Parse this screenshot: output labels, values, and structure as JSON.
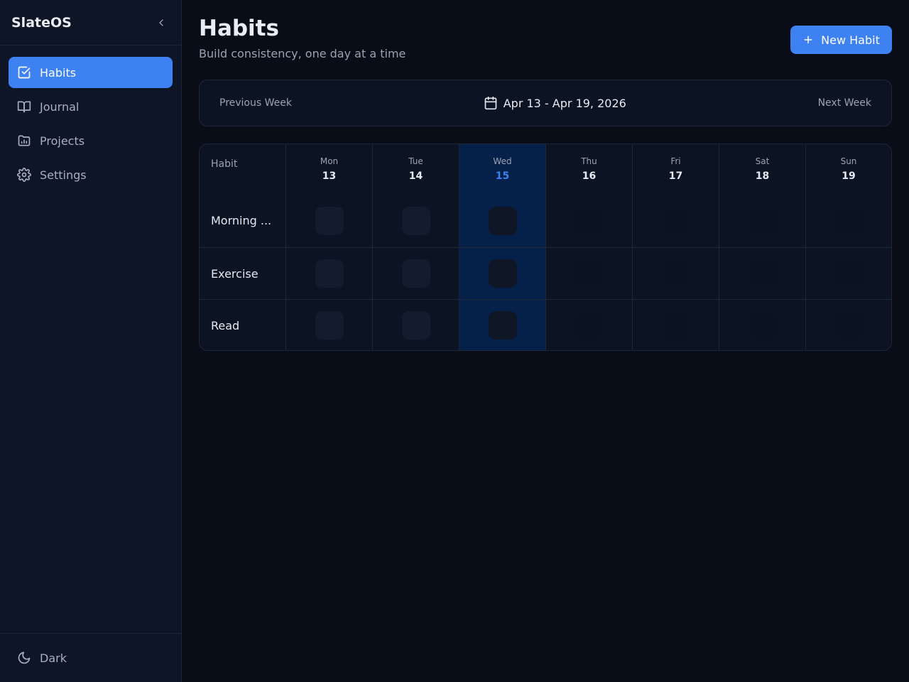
{
  "app": {
    "brand": "SlateOS"
  },
  "sidebar": {
    "items": [
      {
        "label": "Habits",
        "icon": "check-square-icon",
        "active": true
      },
      {
        "label": "Journal",
        "icon": "book-open-icon",
        "active": false
      },
      {
        "label": "Projects",
        "icon": "folder-chart-icon",
        "active": false
      },
      {
        "label": "Settings",
        "icon": "gear-icon",
        "active": false
      }
    ],
    "theme_label": "Dark",
    "theme_icon": "moon-icon"
  },
  "header": {
    "title": "Habits",
    "subtitle": "Build consistency, one day at a time",
    "new_button_label": "New Habit"
  },
  "week": {
    "prev_label": "Previous Week",
    "next_label": "Next Week",
    "range": "Apr 13 - Apr 19, 2026"
  },
  "grid": {
    "habit_header": "Habit",
    "days": [
      {
        "name": "Mon",
        "num": "13"
      },
      {
        "name": "Tue",
        "num": "14"
      },
      {
        "name": "Wed",
        "num": "15",
        "today": true
      },
      {
        "name": "Thu",
        "num": "16"
      },
      {
        "name": "Fri",
        "num": "17"
      },
      {
        "name": "Sat",
        "num": "18"
      },
      {
        "name": "Sun",
        "num": "19"
      }
    ],
    "habits": [
      {
        "name": "Morning ..."
      },
      {
        "name": "Exercise"
      },
      {
        "name": "Read"
      }
    ]
  },
  "colors": {
    "accent": "#3d82f0",
    "background": "#090d17",
    "sidebar": "#0d1526",
    "today_column": "#062149"
  }
}
